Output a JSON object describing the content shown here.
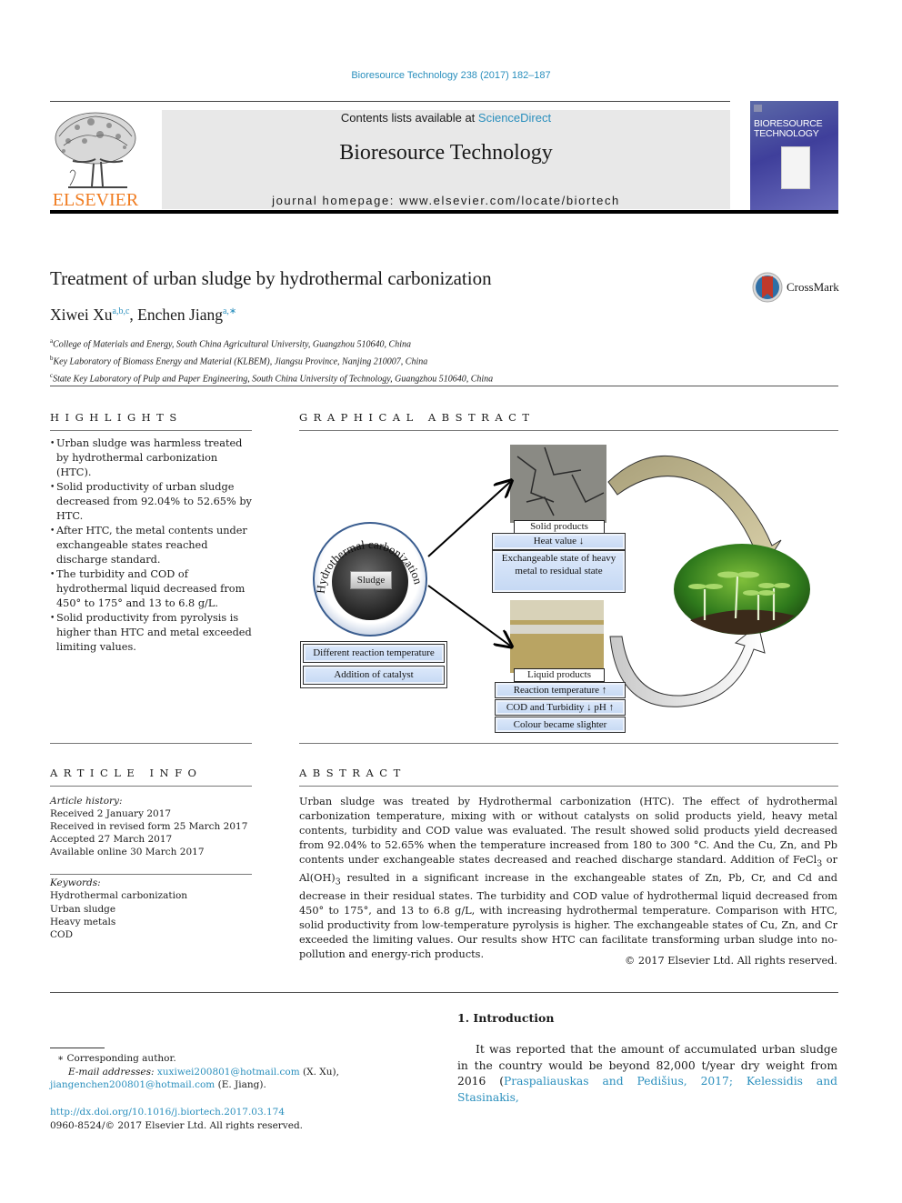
{
  "header": {
    "citation": "Bioresource Technology 238 (2017) 182–187",
    "contents_prefix": "Contents lists available at ",
    "contents_link": "ScienceDirect",
    "journal_name": "Bioresource Technology",
    "homepage": "journal homepage: www.elsevier.com/locate/biortech",
    "publisher_logo_text": "ELSEVIER",
    "cover_title_line1": "BIORESOURCE",
    "cover_title_line2": "TECHNOLOGY"
  },
  "article": {
    "title": "Treatment of urban sludge by hydrothermal carbonization",
    "crossmark_label": "CrossMark",
    "authors": [
      {
        "name": "Xiwei Xu",
        "sup": "a,b,c"
      },
      {
        "name": "Enchen Jiang",
        "sup": "a,∗"
      }
    ],
    "author_separator": ", ",
    "affiliations": [
      {
        "key": "a",
        "text": "College of Materials and Energy, South China Agricultural University, Guangzhou 510640, China"
      },
      {
        "key": "b",
        "text": "Key Laboratory of Biomass Energy and Material (KLBEM), Jiangsu Province, Nanjing 210007, China"
      },
      {
        "key": "c",
        "text": "State Key Laboratory of Pulp and Paper Engineering, South China University of Technology, Guangzhou 510640, China"
      }
    ]
  },
  "highlights": {
    "heading": "HIGHLIGHTS",
    "items": [
      "Urban sludge was harmless treated by hydrothermal carbonization (HTC).",
      "Solid productivity of urban sludge decreased from 92.04% to 52.65% by HTC.",
      "After HTC, the metal contents under exchangeable states reached discharge standard.",
      "The turbidity and COD of hydrothermal liquid decreased from 450° to 175° and 13 to 6.8 g/L.",
      "Solid productivity from pyrolysis is higher than HTC and metal exceeded limiting values."
    ]
  },
  "graphical_abstract": {
    "heading": "GRAPHICAL ABSTRACT",
    "ring_label": "Hydrothermal carbonization",
    "center_label": "Sludge",
    "conditions": [
      "Different reaction temperature",
      "Addition of catalyst"
    ],
    "solid_label": "Solid products",
    "solid_effects": [
      "Heat value ↓",
      "Exchangeable state of heavy metal to residual state"
    ],
    "liquid_label": "Liquid products",
    "liquid_effects": [
      "Reaction temperature ↑",
      "COD and Turbidity ↓ pH ↑",
      "Colour became slighter"
    ]
  },
  "article_info": {
    "heading": "ARTICLE INFO",
    "history_label": "Article history:",
    "history": [
      "Received 2 January 2017",
      "Received in revised form 25 March 2017",
      "Accepted 27 March 2017",
      "Available online 30 March 2017"
    ],
    "keywords_label": "Keywords:",
    "keywords": [
      "Hydrothermal carbonization",
      "Urban sludge",
      "Heavy metals",
      "COD"
    ]
  },
  "abstract": {
    "heading": "ABSTRACT",
    "text_part1": "Urban sludge was treated by Hydrothermal carbonization (HTC). The effect of hydrothermal carboniza­tion temperature, mixing with or without catalysts on solid products yield, heavy metal contents, turbid­ity and COD value was evaluated. The result showed solid products yield decreased from 92.04% to 52.65% when the temperature increased from 180 to 300 °C. And the Cu, Zn, and Pb contents under exchangeable states decreased and reached discharge standard. Addition of FeCl",
    "text_sub1": "3",
    "text_part2": " or Al(OH)",
    "text_sub2": "3",
    "text_part3": " resulted in a significant increase in the exchangeable states of Zn, Pb, Cr, and Cd and decrease in their residual states. The turbidity and COD value of hydrothermal liquid decreased from 450° to 175°, and 13 to 6.8 g/L, with increasing hydrothermal temperature. Comparison with HTC, solid productivity from low-temperature pyrolysis is higher. The exchangeable states of Cu, Zn, and Cr exceeded the limiting values. Our results show HTC can facilitate transforming urban sludge into no-pollution and energy-rich products.",
    "copyright": "© 2017 Elsevier Ltd. All rights reserved."
  },
  "introduction": {
    "heading": "1. Introduction",
    "text": "It was reported that the amount of accumulated urban sludge in the country would be beyond 82,000 t/year dry weight from 2016 (",
    "citation_link": "Praspaliauskas and Pedišius, 2017; Kelessidis and Stasinakis,"
  },
  "footnote": {
    "corresponding": "∗ Corresponding author.",
    "email_label": "E-mail addresses:",
    "email1": "xuxiwei200801@hotmail.com",
    "email1_owner": " (X. Xu), ",
    "email2": "jiangenchen200801@hotmail.com",
    "email2_owner": " (E. Jiang).",
    "doi": "http://dx.doi.org/10.1016/j.biortech.2017.03.174",
    "issn_copyright": "0960-8524/© 2017 Elsevier Ltd. All rights reserved."
  }
}
